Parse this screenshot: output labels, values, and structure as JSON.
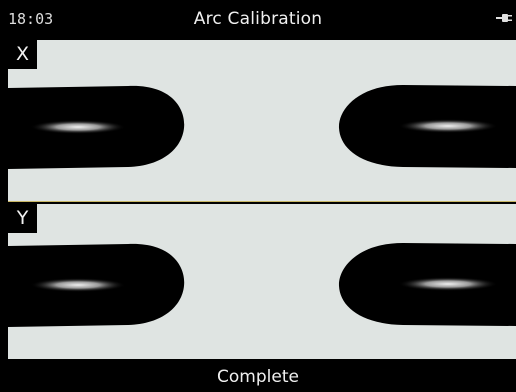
{
  "status_bar": {
    "time": "18:03",
    "title": "Arc Calibration",
    "power_icon": "plug-icon"
  },
  "panels": [
    {
      "axis_label": "X"
    },
    {
      "axis_label": "Y"
    }
  ],
  "footer": {
    "status": "Complete"
  },
  "colors": {
    "background": "#000000",
    "panel": "#dfe4e2",
    "fiber": "#000000",
    "arc_glow": "#b8b8b8",
    "divider": "#c9b765"
  }
}
